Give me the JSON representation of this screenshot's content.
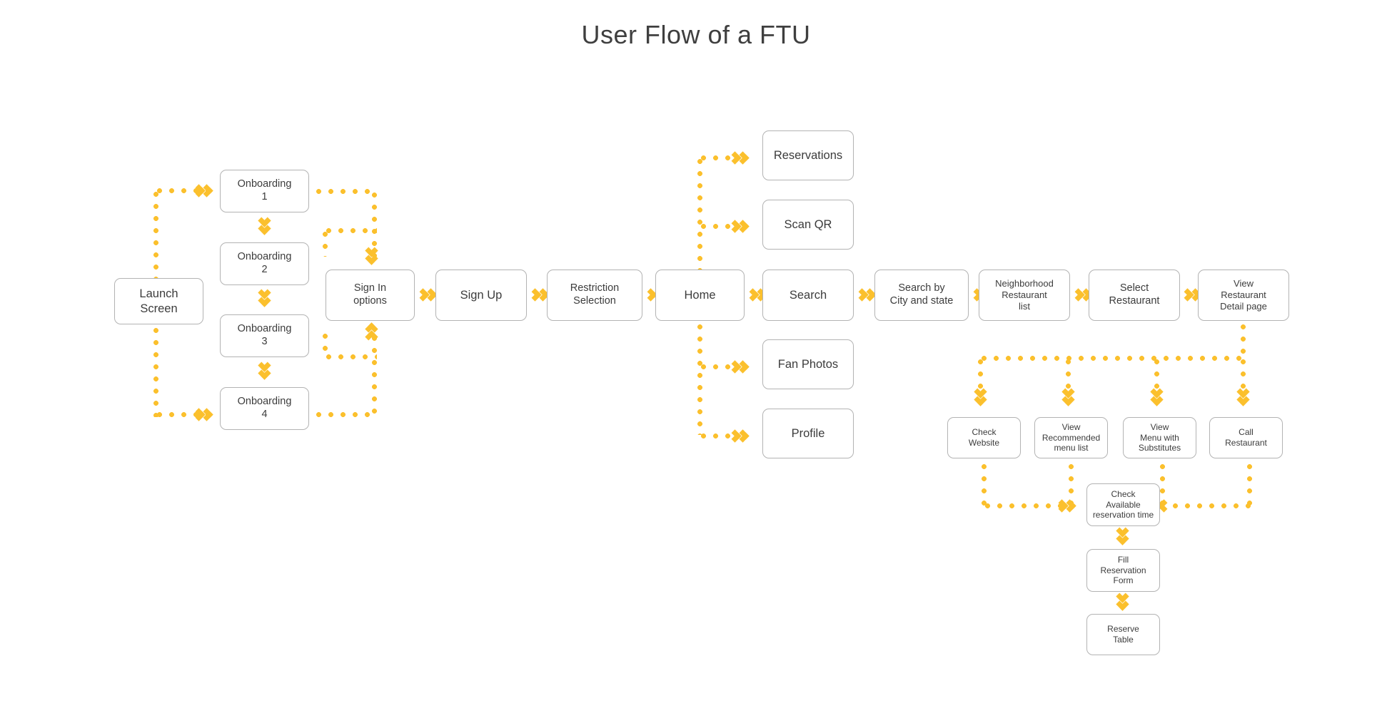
{
  "title": "User Flow of a FTU",
  "colors": {
    "accent": "#FBC02D",
    "node_border": "#b3b3b3",
    "node_text": "#3c3c3c",
    "background": "#ffffff"
  },
  "nodes": {
    "launch_screen": "Launch\nScreen",
    "onboarding_1": "Onboarding\n1",
    "onboarding_2": "Onboarding\n2",
    "onboarding_3": "Onboarding\n3",
    "onboarding_4": "Onboarding\n4",
    "sign_in_options": "Sign In\noptions",
    "sign_up": "Sign Up",
    "restriction_selection": "Restriction\nSelection",
    "home": "Home",
    "reservations": "Reservations",
    "scan_qr": "Scan QR",
    "search": "Search",
    "fan_photos": "Fan Photos",
    "profile": "Profile",
    "search_by_city_and_state": "Search by\nCity and state",
    "neighborhood_restaurant_list": "Neighborhood\nRestaurant\nlist",
    "select_restaurant": "Select\nRestaurant",
    "view_restaurant_detail_page": "View\nRestaurant\nDetail page",
    "check_website": "Check\nWebsite",
    "view_recommended_menu_list": "View\nRecommended\nmenu list",
    "view_menu_with_substitutes": "View\nMenu with\nSubstitutes",
    "call_restaurant": "Call\nRestaurant",
    "check_available_reservation_time": "Check\nAvailable\nreservation time",
    "fill_reservation_form": "Fill\nReservation\nForm",
    "reserve_table": "Reserve\nTable"
  },
  "icons": {
    "arrow_right": "double-chevron-right-icon",
    "arrow_left": "double-chevron-left-icon",
    "arrow_down": "double-chevron-down-icon",
    "arrow_up": "double-chevron-up-icon"
  }
}
